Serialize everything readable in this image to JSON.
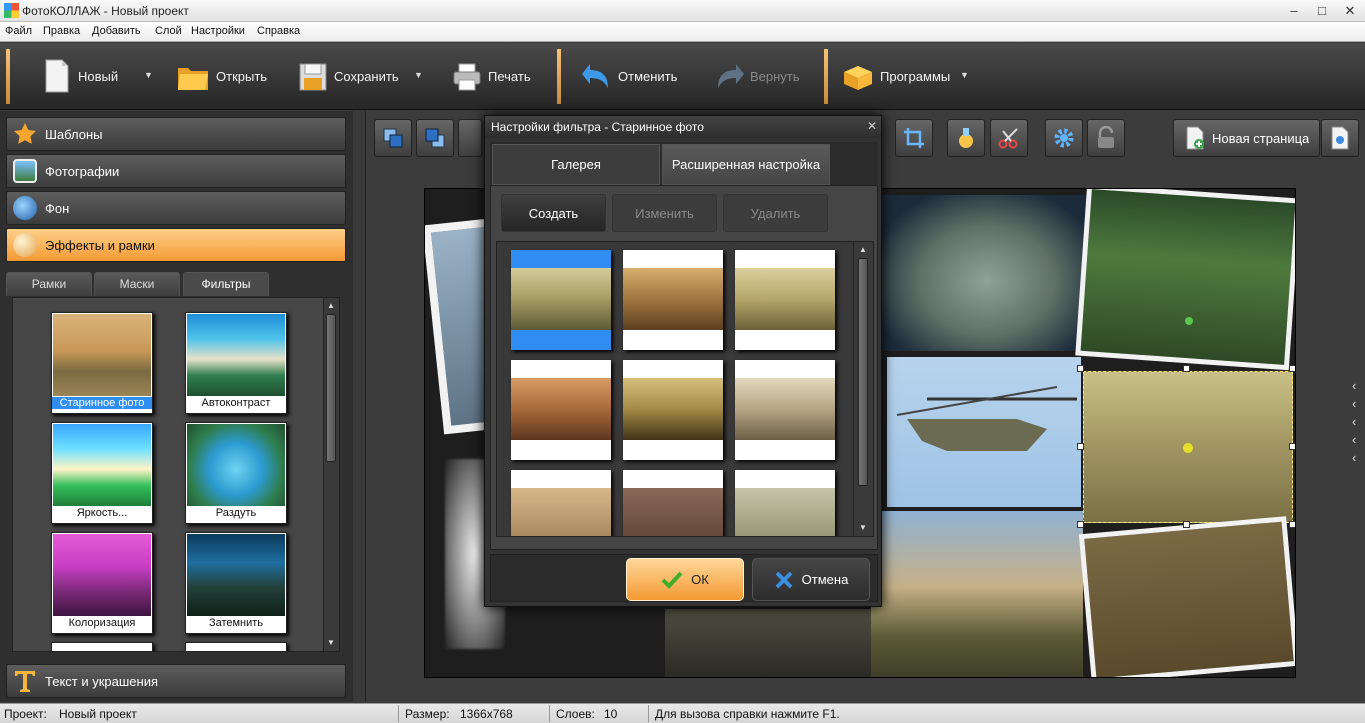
{
  "window": {
    "title": "ФотоКОЛЛАЖ - Новый проект",
    "minimize": "–",
    "maximize": "□",
    "close": "✕"
  },
  "menu": [
    "Файл",
    "Правка",
    "Добавить",
    "Слой",
    "Настройки",
    "Справка"
  ],
  "toolbar": {
    "new_label": "Новый",
    "open_label": "Открыть",
    "save_label": "Сохранить",
    "print_label": "Печать",
    "undo_label": "Отменить",
    "redo_label": "Вернуть",
    "programs_label": "Программы",
    "dropdown_glyph": "▼"
  },
  "left_panel": {
    "sections": [
      "Шаблоны",
      "Фотографии",
      "Фон",
      "Эффекты и рамки"
    ],
    "active_section": "Эффекты и рамки",
    "bottom_section": "Текст и украшения",
    "tabs": [
      "Рамки",
      "Маски",
      "Фильтры"
    ],
    "active_tab": "Фильтры",
    "filters": [
      "Старинное фото",
      "Автоконтраст",
      "Яркость...",
      "Раздуть",
      "Колоризация",
      "Затемнить"
    ],
    "selected_filter": "Старинное фото"
  },
  "canvas_toolbar": {
    "new_page_label": "Новая страница"
  },
  "side_arrows": [
    "‹",
    "‹",
    "‹",
    "‹",
    "‹"
  ],
  "dialog": {
    "title": "Настройки фильтра - Старинное фото",
    "close": "✕",
    "tabs": [
      "Галерея",
      "Расширенная настройка"
    ],
    "active_tab": "Галерея",
    "buttons": {
      "create": "Создать",
      "edit": "Изменить",
      "delete": "Удалить"
    },
    "ok_label": "ОК",
    "cancel_label": "Отмена",
    "presets_selected_index": 0
  },
  "status": {
    "project_label": "Проект:",
    "project_value": "Новый проект",
    "size_label": "Размер:",
    "size_value": "1366x768",
    "layers_label": "Слоев:",
    "layers_value": "10",
    "help": "Для вызова справки нажмите F1."
  },
  "colors": {
    "accent_orange": "#f49a32",
    "selection_blue": "#2f8df2",
    "ok_button": "#f5a94e"
  }
}
